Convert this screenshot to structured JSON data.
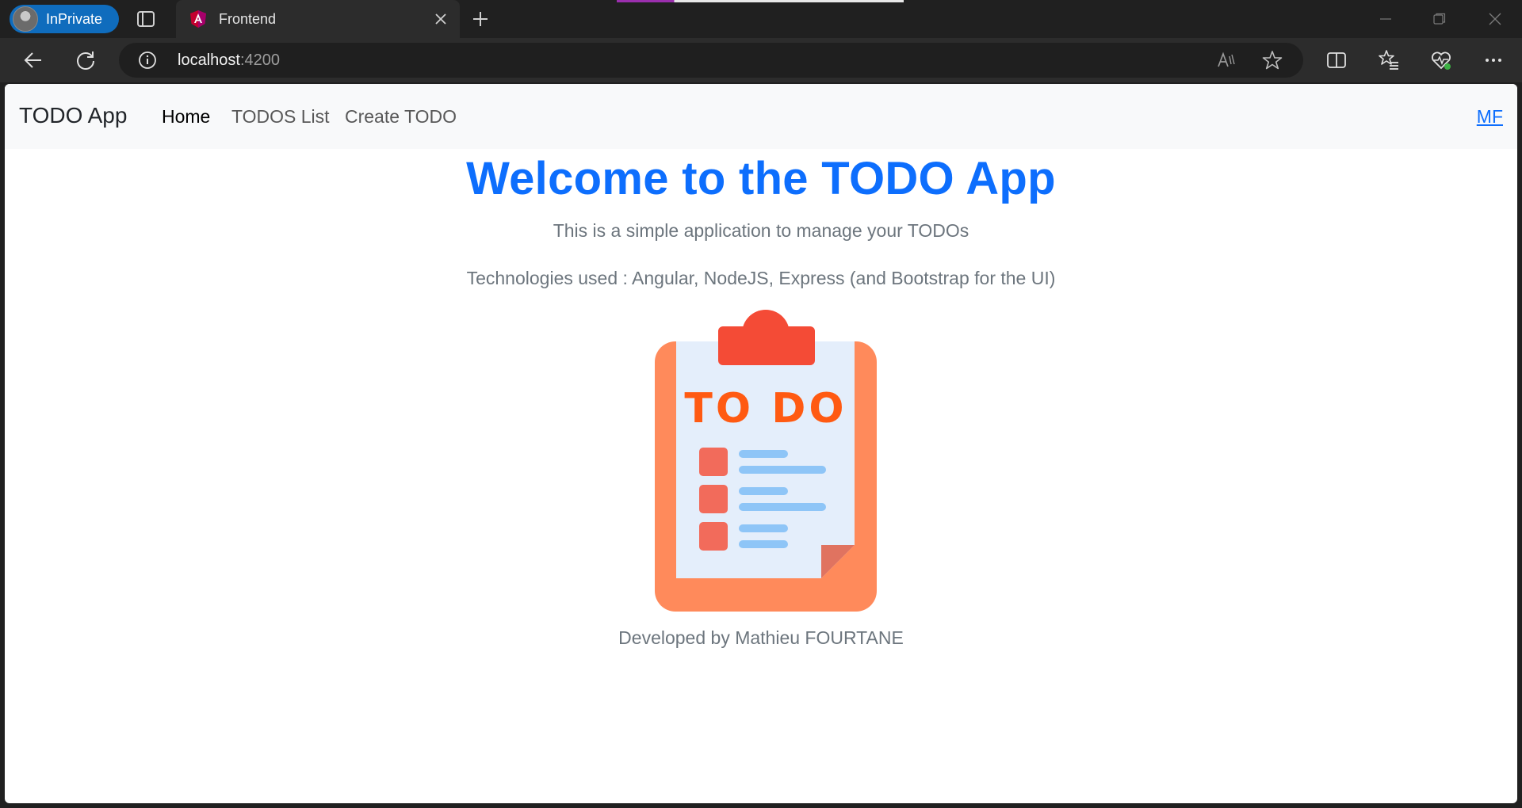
{
  "browser": {
    "profile_label": "InPrivate",
    "tab_title": "Frontend",
    "url_host": "localhost",
    "url_port": ":4200"
  },
  "icons": {
    "profile": "avatar-icon",
    "tab_actions": "tab-actions-icon",
    "favicon": "angular-icon",
    "close_tab": "close-icon",
    "new_tab": "plus-icon",
    "back": "back-arrow-icon",
    "refresh": "refresh-icon",
    "site_info": "info-icon",
    "read_aloud": "read-aloud-icon",
    "favorite": "star-icon",
    "split_screen": "split-screen-icon",
    "favorites": "favorites-icon",
    "browser_essentials": "heartbeat-icon",
    "more": "more-icon"
  },
  "navbar": {
    "brand": "TODO App",
    "links": [
      "Home",
      "TODOS List",
      "Create TODO"
    ],
    "right_link": "MF"
  },
  "main": {
    "title": "Welcome to the TODO App",
    "subtitle": "This is a simple application to manage your TODOs",
    "technologies": "Technologies used : Angular, NodeJS, Express (and Bootstrap for the UI)",
    "illustration_text": "TO DO",
    "footer": "Developed by Mathieu FOURTANE"
  },
  "colors": {
    "brand_blue": "#0d6efd",
    "muted_text": "#6c757d",
    "clipboard_orange": "#ff8a5b",
    "clip_red": "#f44b36",
    "todo_text": "#ff5a12",
    "checkbox_red": "#f26b5b",
    "line_blue": "#8ec5f7",
    "paper": "#e4eefb"
  }
}
